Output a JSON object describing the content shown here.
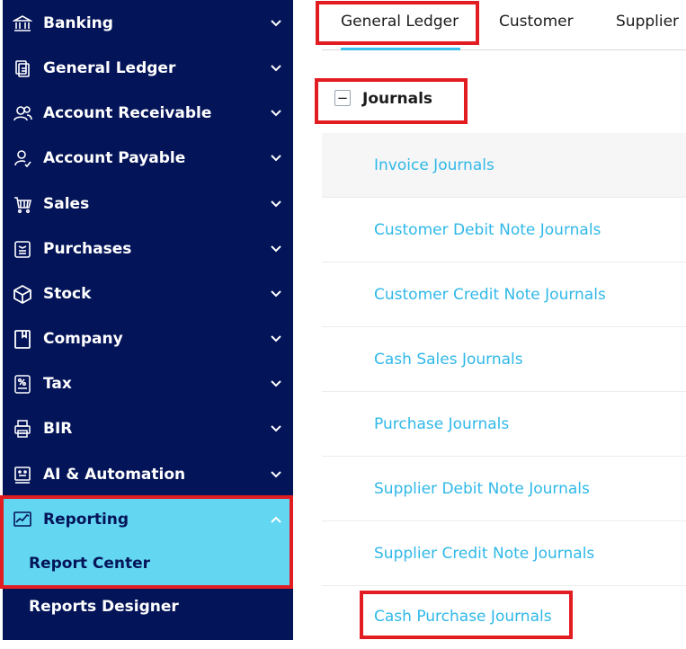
{
  "sidebar": {
    "items": [
      {
        "label": "Banking",
        "icon": "bank-icon"
      },
      {
        "label": "General Ledger",
        "icon": "ledger-icon"
      },
      {
        "label": "Account Receivable",
        "icon": "users-icon"
      },
      {
        "label": "Account Payable",
        "icon": "user-check-icon"
      },
      {
        "label": "Sales",
        "icon": "cart-icon"
      },
      {
        "label": "Purchases",
        "icon": "receipt-icon"
      },
      {
        "label": "Stock",
        "icon": "box-icon"
      },
      {
        "label": "Company",
        "icon": "bookmark-icon"
      },
      {
        "label": "Tax",
        "icon": "percent-icon"
      },
      {
        "label": "BIR",
        "icon": "printer-icon"
      },
      {
        "label": "AI & Automation",
        "icon": "robot-icon"
      }
    ],
    "reporting": {
      "label": "Reporting",
      "icon": "chart-line-icon",
      "sub_items": [
        {
          "label": "Report Center"
        },
        {
          "label": "Reports Designer"
        }
      ]
    }
  },
  "tabs": [
    {
      "label": "General Ledger"
    },
    {
      "label": "Customer"
    },
    {
      "label": "Supplier"
    }
  ],
  "section": {
    "title": "Journals",
    "toggle": "−"
  },
  "journals": [
    {
      "label": "Invoice Journals"
    },
    {
      "label": "Customer Debit Note Journals"
    },
    {
      "label": "Customer Credit Note Journals"
    },
    {
      "label": "Cash Sales Journals"
    },
    {
      "label": "Purchase Journals"
    },
    {
      "label": "Supplier Debit Note Journals"
    },
    {
      "label": "Supplier Credit Note Journals"
    },
    {
      "label": "Cash Purchase Journals"
    }
  ],
  "colors": {
    "sidebar_bg": "#041458",
    "active_bg": "#63d6f2",
    "highlight_border": "#e21d22",
    "link": "#30b8e8",
    "tab_underline": "#3cc2ea"
  }
}
